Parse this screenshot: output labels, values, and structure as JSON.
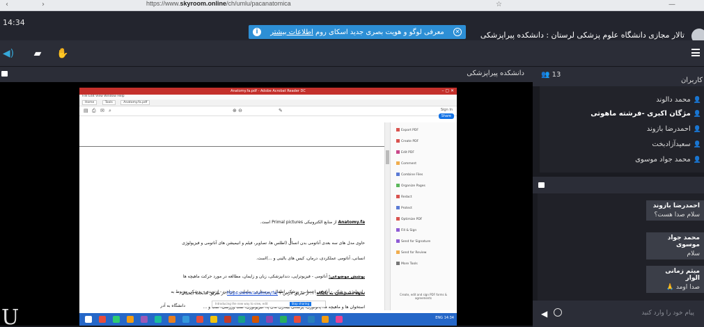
{
  "browser": {
    "url_prefix": "https://www.",
    "url_domain": "skyroom.online",
    "url_suffix": "/ch/umlu/pacanatomica"
  },
  "header": {
    "clock": "14:34",
    "notice_text": "معرفی لوگو و هویت بصری جدید اسکای روم",
    "notice_link": "اطلاعات بیشتر",
    "room_title": "تالار مجازی دانشگاه علوم پزشکی لرستان : دانشکده پیراپزشکی"
  },
  "stage": {
    "title": "دانشکده پیراپزشکی",
    "corner_letter": "U"
  },
  "shared_screen": {
    "window_title": "Anatomy.fa.pdf - Adobe Acrobat Reader DC",
    "menu": "File  Edit  View  Window  Help",
    "tabs": [
      "Home",
      "Tools",
      "Anatomy.fa.pdf"
    ],
    "sign_in": "Sign In",
    "share": "Share",
    "side_tools": [
      "Export PDF",
      "Create PDF",
      "Edit PDF",
      "Comment",
      "Combine Files",
      "Organize Pages",
      "Redact",
      "Protect",
      "Optimize PDF",
      "Fill & Sign",
      "Send for Signature",
      "Send for Review",
      "More Tools"
    ],
    "side_footer": "Create, edit and sign PDF forms & agreements",
    "pdf_lines": [
      {
        "pre": "",
        "u": "Anatomy.fa",
        "post": " از منابع الکترونیکی Primal pictures است."
      },
      {
        "pre": "حاوی مدل های سه بعدی آناتومی بدن انسان (اطلس ها، تصاویر، فیلم و انیمیشن های آناتومی و فیزیولوژی",
        "u": "",
        "post": ""
      },
      {
        "pre": "انسانی، آناتومی عملکردی، درمان، کیس های بالینی و ...)است.",
        "u": "",
        "post": ""
      },
      {
        "pre": "",
        "u": "پوشش موضوعی:",
        "post": " آناتومی - فیزیوتراپی، دندانپزشکی، زبان و زایمان، مطالعه در مورد حرکت ماهیچه ها"
      },
      {
        "pre": "رادیولوژی پزشکی - آناتومی اعصاب - پزشکی اطفال - پرستاری - مامایی - جراحی - ارتوپدی - پزشکی مربوط به",
        "u": "",
        "post": ""
      },
      {
        "pre": "استخوان ها و ماهیچه ها، پاتولوژی، پزشکی بیماری های پا، فیزیولوژی، طب ورزشی، طب و ...",
        "u": "",
        "post": ""
      },
      {
        "pre": "",
        "u": "نحوه دسترسی به پایگاه",
        "post": ": ۱. از طریق ادرس ",
        "link": "https://www.anatomy.fa/",
        "tail": " ۲. از طریق کتابخانه دیجیتال"
      },
      {
        "pre": "دانشگاه به آدر",
        "u": "",
        "post": ""
      }
    ],
    "notif_text": "Introducing the new way to view, edit",
    "notif_button": "Stop sharing",
    "tray": "ENG 14:34"
  },
  "users": {
    "count": "13",
    "label": "کاربران",
    "list": [
      {
        "name": "محمد دالوند",
        "bold": false
      },
      {
        "name": "مژگان اکبری -فرشته ماهوتی",
        "bold": true
      },
      {
        "name": "احمدرضا بازوند",
        "bold": false
      },
      {
        "name": "سعیدآزادبخت",
        "bold": false
      },
      {
        "name": "محمد جواد موسوی",
        "bold": false
      }
    ]
  },
  "chat": {
    "messages": [
      {
        "sender": "احمدرضا بازوند",
        "text": "سلام صدا هست؟"
      },
      {
        "sender": "محمد جواد موسوی",
        "text": "سلام"
      },
      {
        "sender": "میثم زمانی الوار",
        "text": "صدا اومد 🙏"
      }
    ],
    "input_placeholder": "پیام خود را وارد کنید"
  },
  "colors": {
    "accent_blue": "#2d8fd5",
    "panel_dark": "#2b2d37",
    "user_icon": "#f1c40f",
    "taskbar": "#2567c8",
    "pdf_titlebar": "#c4302b"
  }
}
